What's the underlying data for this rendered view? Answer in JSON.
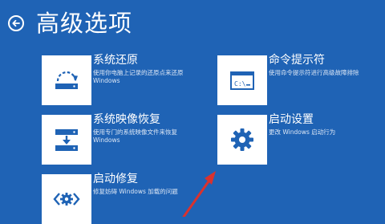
{
  "header": {
    "title": "高级选项"
  },
  "options": [
    {
      "title": "系统还原",
      "desc_line1": "使用你电脑上记录的还原点来还原",
      "desc_line2": "Windows",
      "icon": "system-restore-icon"
    },
    {
      "title": "命令提示符",
      "desc_line1": "使用命令提示符进行高级故障排除",
      "desc_line2": "",
      "icon": "command-prompt-icon",
      "icon_text": "C:\\"
    },
    {
      "title": "系统映像恢复",
      "desc_line1": "使用专门的系统映像文件来恢复",
      "desc_line2": "Windows",
      "icon": "system-image-icon"
    },
    {
      "title": "启动设置",
      "desc_line1": "更改 Windows 启动行为",
      "desc_line2": "",
      "icon": "gear-icon"
    },
    {
      "title": "启动修复",
      "desc_line1": "修复妨碍 Windows 加载的问题",
      "desc_line2": "",
      "icon": "startup-repair-icon"
    }
  ],
  "colors": {
    "background": "#1f63b5",
    "icon_tile": "#ffffff",
    "icon_fg": "#1f63b5",
    "annotation_arrow": "#d9322e"
  }
}
